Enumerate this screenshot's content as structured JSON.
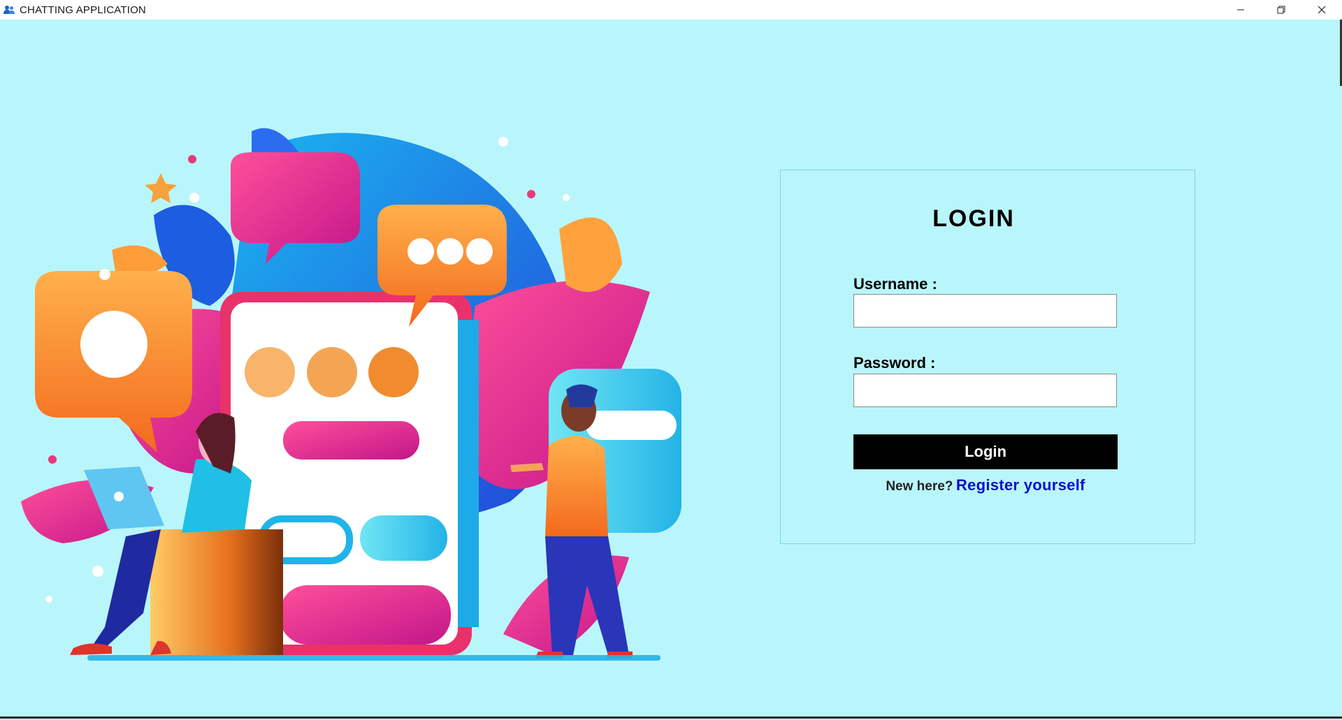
{
  "window": {
    "title": "CHATTING APPLICATION",
    "icon": "users-icon",
    "controls": [
      "minimize-icon",
      "restore-icon",
      "close-icon"
    ]
  },
  "illustration": {
    "description_icon": "chat-illustration"
  },
  "login": {
    "title": "LOGIN",
    "username_label": "Username :",
    "username_value": "",
    "password_label": "Password :",
    "password_value": "",
    "button_label": "Login",
    "new_here": "New here?",
    "register_label": "Register yourself"
  },
  "colors": {
    "background": "#b9f6fb",
    "button": "#000000",
    "link": "#0a0fcf"
  }
}
